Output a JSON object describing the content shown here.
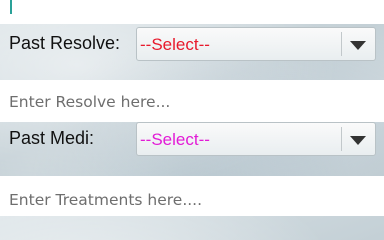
{
  "top_field": {
    "value": ""
  },
  "past_resolve": {
    "label": "Past Resolve:",
    "select_value": "--Select--",
    "select_color": "#e8192c"
  },
  "resolve_input": {
    "placeholder": "Enter Resolve here..."
  },
  "past_medi": {
    "label": "Past Medi:",
    "select_value": "--Select--",
    "select_color": "#e21bd6"
  },
  "treatments_input": {
    "placeholder": "Enter Treatments here...."
  },
  "icons": {
    "dropdown": "chevron-down-icon"
  }
}
